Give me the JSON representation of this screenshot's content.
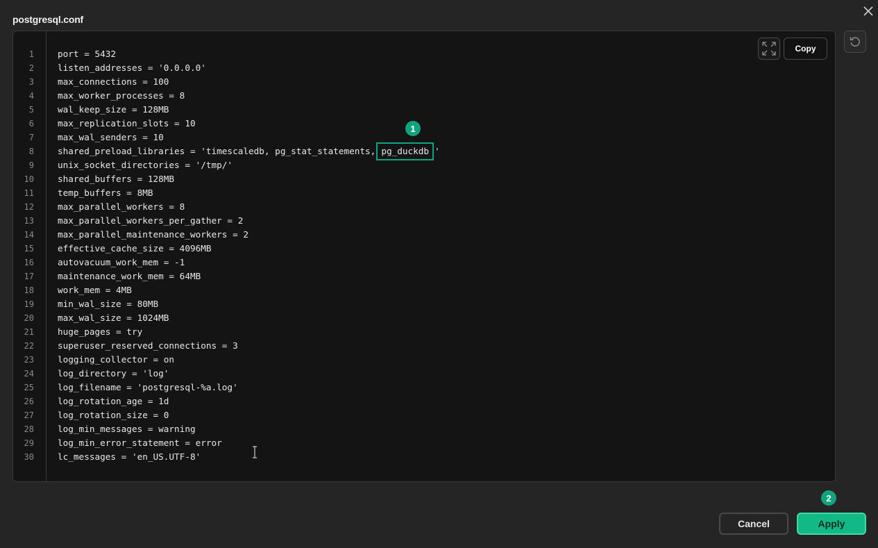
{
  "dialog": {
    "title": "postgresql.conf",
    "copy_label": "Copy",
    "cancel_label": "Cancel",
    "apply_label": "Apply"
  },
  "markers": {
    "first": "1",
    "second": "2"
  },
  "colors": {
    "accent": "#10a37f",
    "apply_bg": "#12b886",
    "background": "#252525",
    "editor_bg": "#141414"
  },
  "icons": [
    "close-icon",
    "expand-icon",
    "reset-icon"
  ],
  "highlight": {
    "line": 8,
    "text": "pg_duckdb"
  },
  "code": {
    "lines": [
      "port = 5432",
      "listen_addresses = '0.0.0.0'",
      "max_connections = 100",
      "max_worker_processes = 8",
      "wal_keep_size = 128MB",
      "max_replication_slots = 10",
      "max_wal_senders = 10",
      "shared_preload_libraries = 'timescaledb, pg_stat_statements,",
      "unix_socket_directories = '/tmp/'",
      "shared_buffers = 128MB",
      "temp_buffers = 8MB",
      "max_parallel_workers = 8",
      "max_parallel_workers_per_gather = 2",
      "max_parallel_maintenance_workers = 2",
      "effective_cache_size = 4096MB",
      "autovacuum_work_mem = -1",
      "maintenance_work_mem = 64MB",
      "work_mem = 4MB",
      "min_wal_size = 80MB",
      "max_wal_size = 1024MB",
      "huge_pages = try",
      "superuser_reserved_connections = 3",
      "logging_collector = on",
      "log_directory = 'log'",
      "log_filename = 'postgresql-%a.log'",
      "log_rotation_age = 1d",
      "log_rotation_size = 0",
      "log_min_messages = warning",
      "log_min_error_statement = error",
      "lc_messages = 'en_US.UTF-8'"
    ],
    "line8_tail": "'"
  }
}
